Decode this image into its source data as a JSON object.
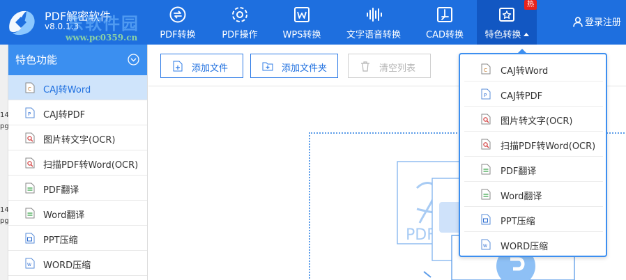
{
  "app": {
    "title": "PDF解密软件",
    "version": "v8.0.1.3",
    "watermark_text": "东软件园",
    "watermark_url": "www.pc0359.cn"
  },
  "nav": {
    "tabs": [
      {
        "label": "PDF转换",
        "icon": "pdf-convert-icon"
      },
      {
        "label": "PDF操作",
        "icon": "gear-icon"
      },
      {
        "label": "WPS转换",
        "icon": "wps-icon"
      },
      {
        "label": "文字语音转换",
        "icon": "waveform-icon"
      },
      {
        "label": "CAD转换",
        "icon": "cad-icon"
      },
      {
        "label": "特色转换",
        "icon": "star-convert-icon"
      }
    ],
    "hot_badge": "热",
    "login_label": "登录注册"
  },
  "left_edge": {
    "texts": [
      "14",
      "pg",
      "14",
      "pg"
    ]
  },
  "sidebar": {
    "header": "特色功能",
    "items": [
      {
        "label": "CAJ转Word",
        "icon": "caj-file-icon"
      },
      {
        "label": "CAJ转PDF",
        "icon": "pdf-file-icon"
      },
      {
        "label": "图片转文字(OCR)",
        "icon": "ocr-file-icon"
      },
      {
        "label": "扫描PDF转Word(OCR)",
        "icon": "ocr-file-icon"
      },
      {
        "label": "PDF翻译",
        "icon": "translate-file-icon"
      },
      {
        "label": "Word翻译",
        "icon": "translate-file-icon"
      },
      {
        "label": "PPT压缩",
        "icon": "ppt-file-icon"
      },
      {
        "label": "WORD压缩",
        "icon": "word-file-icon"
      }
    ]
  },
  "toolbar": {
    "add_file": "添加文件",
    "add_folder": "添加文件夹",
    "clear_list": "清空列表"
  },
  "illustration": {
    "file_label": "PDF"
  },
  "dropdown": {
    "items": [
      {
        "label": "CAJ转Word",
        "icon": "caj-file-icon"
      },
      {
        "label": "CAJ转PDF",
        "icon": "pdf-file-icon"
      },
      {
        "label": "图片转文字(OCR)",
        "icon": "ocr-file-icon"
      },
      {
        "label": "扫描PDF转Word(OCR)",
        "icon": "ocr-file-icon"
      },
      {
        "label": "PDF翻译",
        "icon": "translate-file-icon"
      },
      {
        "label": "Word翻译",
        "icon": "translate-file-icon"
      },
      {
        "label": "PPT压缩",
        "icon": "ppt-file-icon"
      },
      {
        "label": "WORD压缩",
        "icon": "word-file-icon"
      }
    ]
  },
  "colors": {
    "topbar": "#1e6fdf",
    "active_tab": "#1257c2",
    "sidebar_header": "#3b8ff0",
    "selected_row": "#cfe4fb",
    "accent": "#2e7be6",
    "badge": "#e8231b"
  }
}
